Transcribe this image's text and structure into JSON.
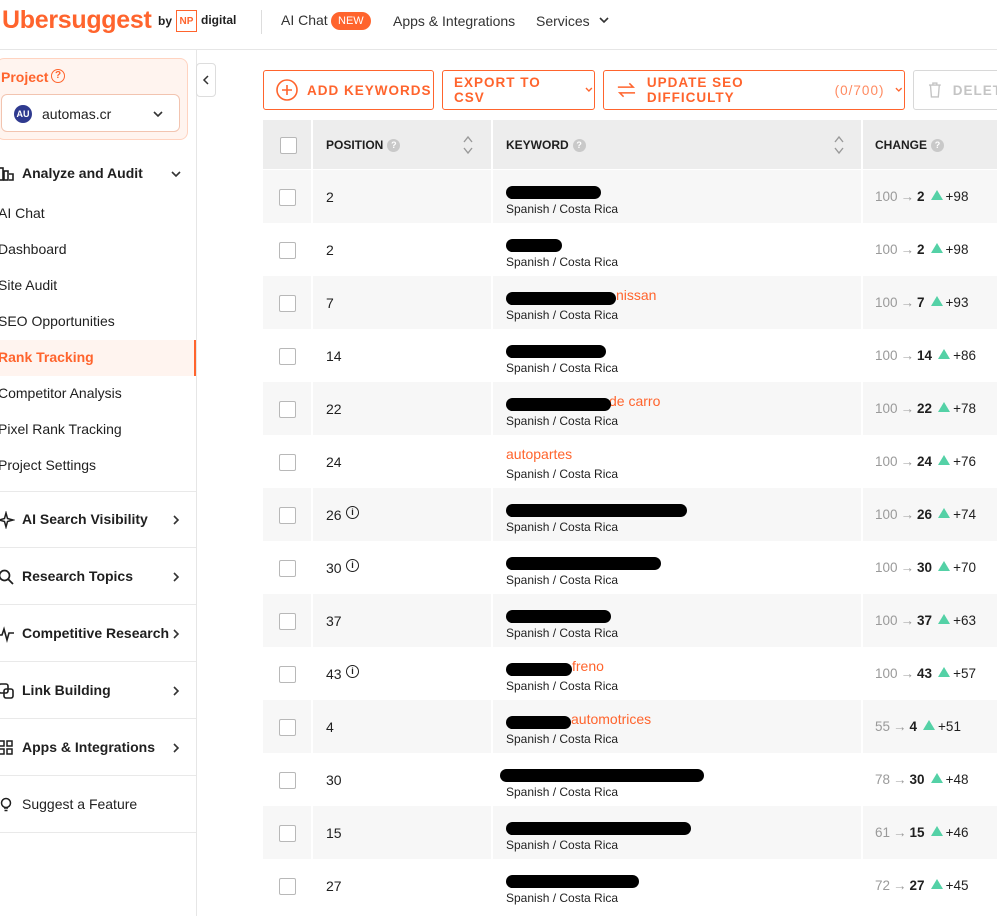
{
  "brand": {
    "logo": "Ubersuggest",
    "by": "by",
    "np": "NP",
    "digital": "digital"
  },
  "topnav": {
    "ai_chat": "AI Chat",
    "new_badge": "NEW",
    "apps": "Apps & Integrations",
    "services": "Services"
  },
  "sidebar": {
    "project_label": "Project",
    "project_name": "automas.cr",
    "project_avatar": "AU",
    "analyze": "Analyze and Audit",
    "sub_items": [
      "AI Chat",
      "Dashboard",
      "Site Audit",
      "SEO Opportunities",
      "Rank Tracking",
      "Competitor Analysis",
      "Pixel Rank Tracking",
      "Project Settings"
    ],
    "active_item": "Rank Tracking",
    "sections": [
      "AI Search Visibility",
      "Research Topics",
      "Competitive Research",
      "Link Building",
      "Apps & Integrations",
      "Suggest a Feature"
    ]
  },
  "toolbar": {
    "add": "ADD KEYWORDS",
    "export": "EXPORT TO CSV",
    "update": "UPDATE SEO DIFFICULTY",
    "update_count": "(0/700)",
    "delete": "DELETE"
  },
  "table": {
    "headers": {
      "position": "POSITION",
      "keyword": "KEYWORD",
      "change": "CHANGE"
    },
    "rows": [
      {
        "position": "2",
        "info": false,
        "keyword": "",
        "lang": "Spanish / Costa Rica",
        "from": "100",
        "to": "2",
        "delta": "+98"
      },
      {
        "position": "2",
        "info": false,
        "keyword": "",
        "lang": "Spanish / Costa Rica",
        "from": "100",
        "to": "2",
        "delta": "+98"
      },
      {
        "position": "7",
        "info": false,
        "keyword": "nissan",
        "lang": "Spanish / Costa Rica",
        "from": "100",
        "to": "7",
        "delta": "+93"
      },
      {
        "position": "14",
        "info": false,
        "keyword": "",
        "lang": "Spanish / Costa Rica",
        "from": "100",
        "to": "14",
        "delta": "+86"
      },
      {
        "position": "22",
        "info": false,
        "keyword": "de carro",
        "lang": "Spanish / Costa Rica",
        "from": "100",
        "to": "22",
        "delta": "+78"
      },
      {
        "position": "24",
        "info": false,
        "keyword": "autopartes",
        "lang": "Spanish / Costa Rica",
        "from": "100",
        "to": "24",
        "delta": "+76"
      },
      {
        "position": "26",
        "info": true,
        "keyword": "",
        "lang": "Spanish / Costa Rica",
        "from": "100",
        "to": "26",
        "delta": "+74"
      },
      {
        "position": "30",
        "info": true,
        "keyword": "",
        "lang": "Spanish / Costa Rica",
        "from": "100",
        "to": "30",
        "delta": "+70"
      },
      {
        "position": "37",
        "info": false,
        "keyword": "",
        "lang": "Spanish / Costa Rica",
        "from": "100",
        "to": "37",
        "delta": "+63"
      },
      {
        "position": "43",
        "info": true,
        "keyword": "freno",
        "lang": "Spanish / Costa Rica",
        "from": "100",
        "to": "43",
        "delta": "+57"
      },
      {
        "position": "4",
        "info": false,
        "keyword": "automotrices",
        "lang": "Spanish / Costa Rica",
        "from": "55",
        "to": "4",
        "delta": "+51"
      },
      {
        "position": "30",
        "info": false,
        "keyword": "",
        "lang": "Spanish / Costa Rica",
        "from": "78",
        "to": "30",
        "delta": "+48"
      },
      {
        "position": "15",
        "info": false,
        "keyword": "",
        "lang": "Spanish / Costa Rica",
        "from": "61",
        "to": "15",
        "delta": "+46"
      },
      {
        "position": "27",
        "info": false,
        "keyword": "",
        "lang": "Spanish / Costa Rica",
        "from": "72",
        "to": "27",
        "delta": "+45"
      }
    ]
  },
  "colors": {
    "accent": "#ff642d",
    "up": "#54d1a6"
  }
}
